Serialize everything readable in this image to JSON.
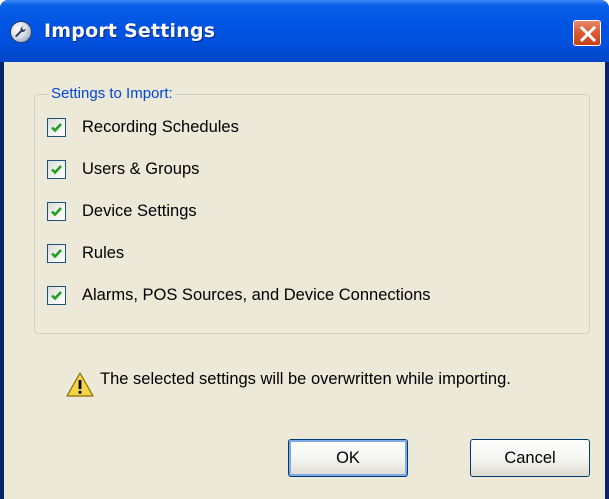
{
  "window": {
    "title": "Import Settings",
    "title_icon": "settings-icon",
    "close_icon": "close-icon"
  },
  "settings_group": {
    "legend": "Settings to Import:",
    "items": [
      {
        "label": "Recording Schedules",
        "checked": true
      },
      {
        "label": "Users & Groups",
        "checked": true
      },
      {
        "label": "Device Settings",
        "checked": true
      },
      {
        "label": "Rules",
        "checked": true
      },
      {
        "label": "Alarms, POS Sources, and Device Connections",
        "checked": true
      }
    ]
  },
  "warning": {
    "icon": "warning-icon",
    "text": "The selected settings will be overwritten while importing."
  },
  "buttons": {
    "ok_label": "OK",
    "cancel_label": "Cancel"
  },
  "colors": {
    "titlebar": "#0054e3",
    "dialog_background": "#ece9d8",
    "group_legend": "#0046d5",
    "checkmark": "#21a121",
    "close_button": "#dd5b36"
  }
}
